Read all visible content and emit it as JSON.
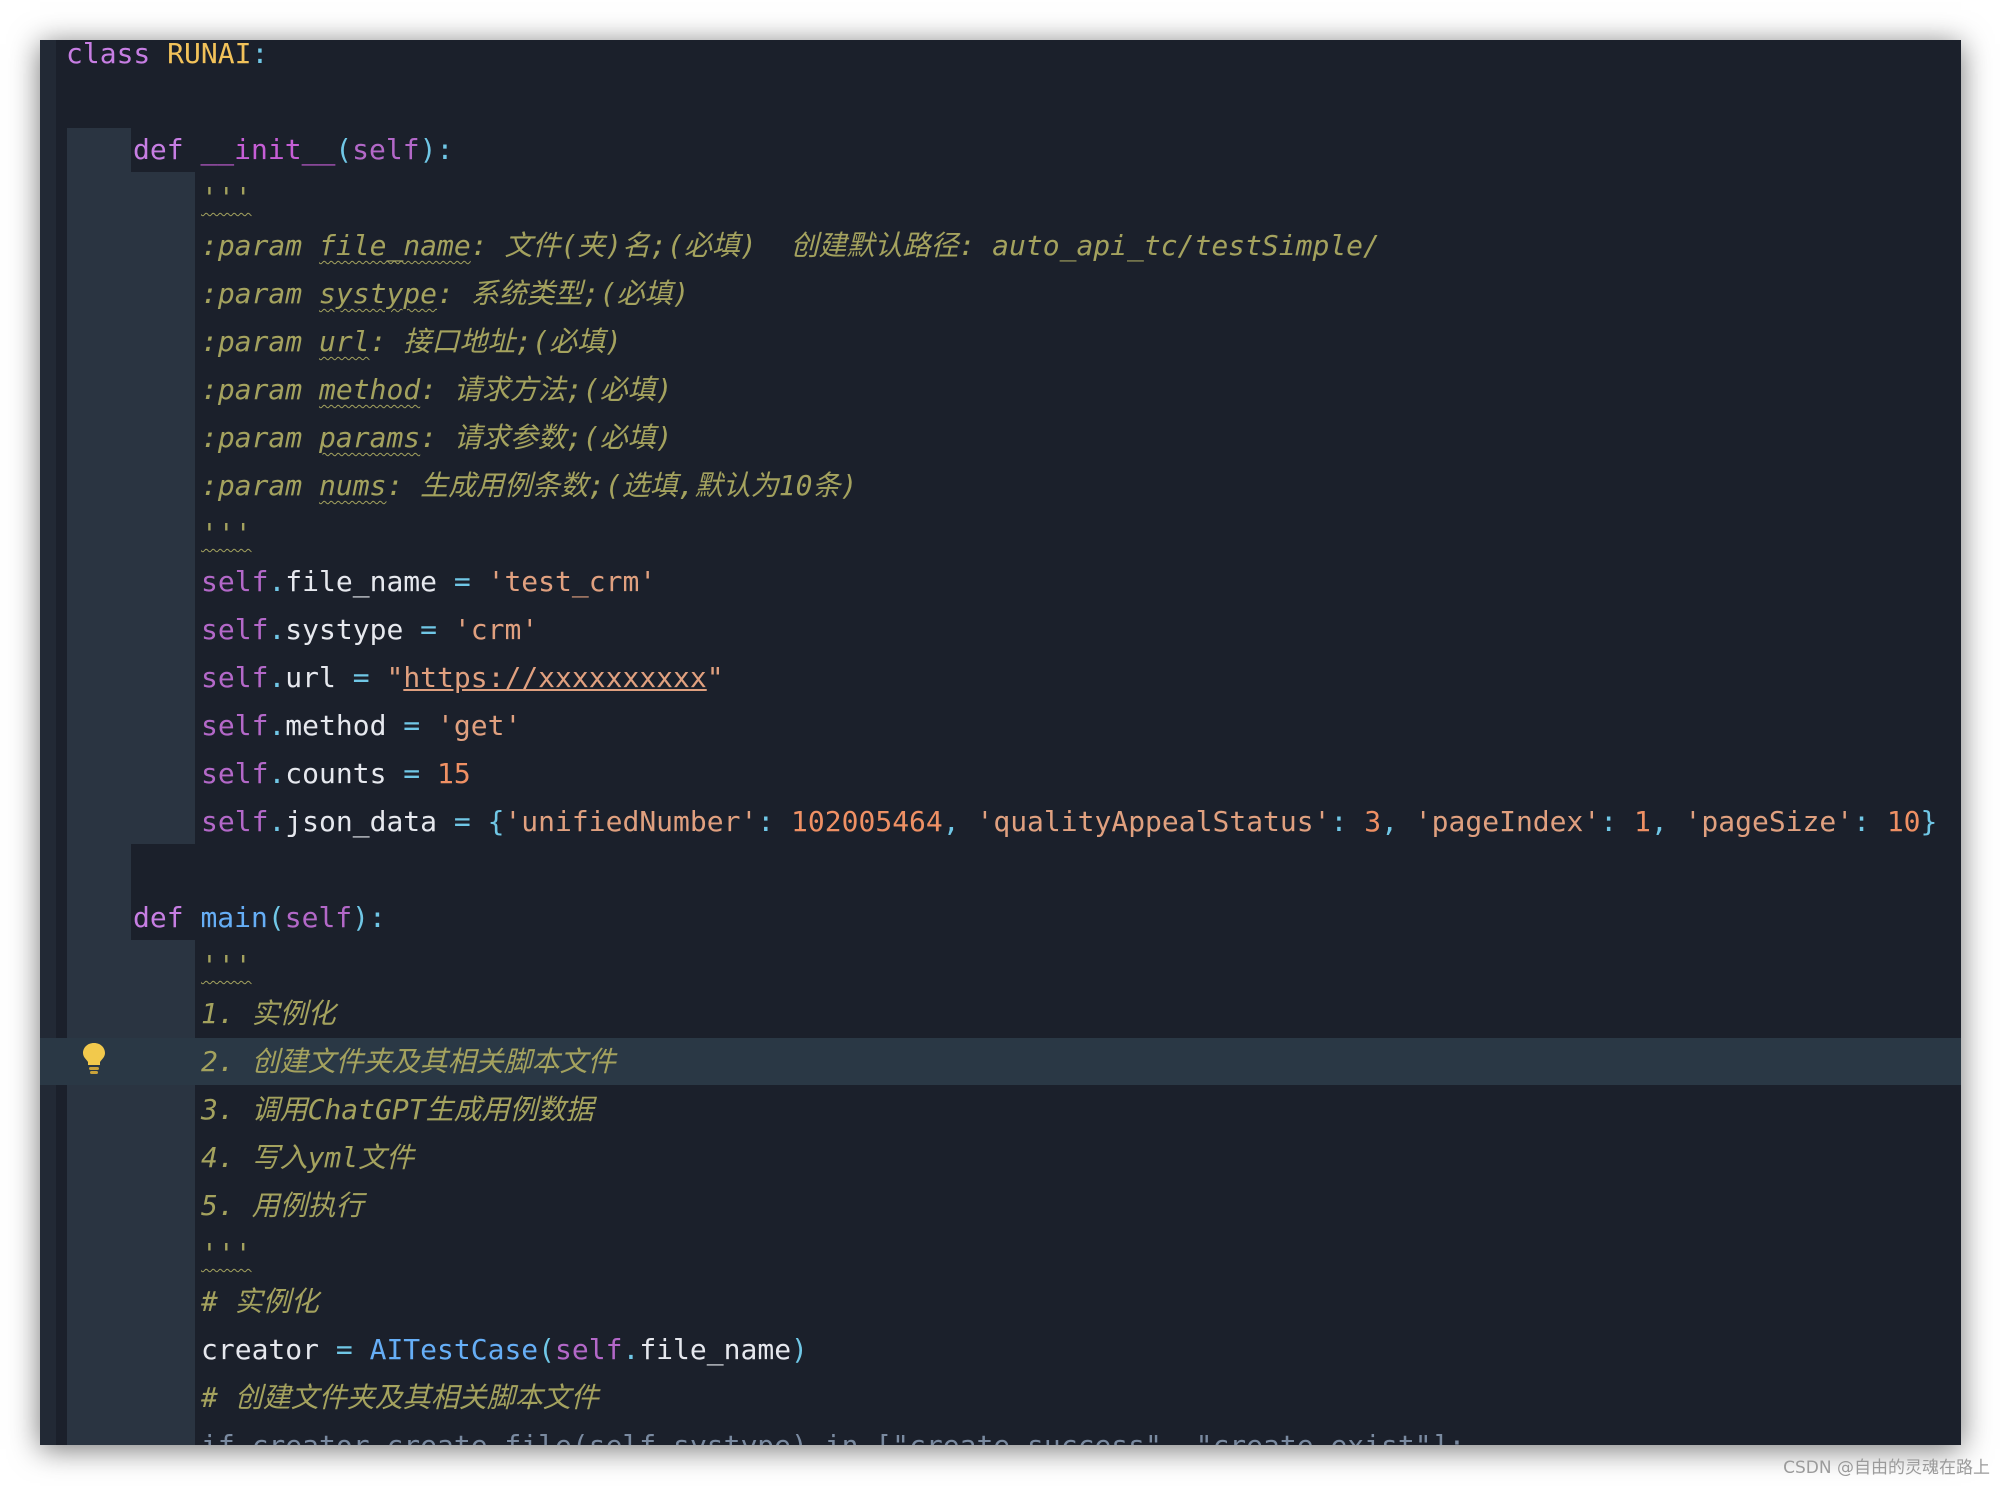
{
  "code": {
    "class_kw": "class",
    "class_name": "RUNAI",
    "colon": ":",
    "def_kw": "def",
    "init_name": "__init__",
    "main_name": "main",
    "self_kw": "self",
    "paren_open": "(",
    "paren_close_colon": "):",
    "triple_quote": "'''",
    "param_kw": ":param",
    "params": [
      {
        "name": "file_name",
        "desc": ": 文件(夹)名;(必填)  创建默认路径: auto_api_tc/testSimple/"
      },
      {
        "name": "systype",
        "desc": ": 系统类型;(必填)"
      },
      {
        "name": "url",
        "desc": ": 接口地址;(必填)"
      },
      {
        "name": "method",
        "desc": ": 请求方法;(必填)"
      },
      {
        "name": "params",
        "desc": ": 请求参数;(必填)"
      },
      {
        "name": "nums",
        "desc": ": 生成用例条数;(选填,默认为10条)"
      }
    ],
    "assign_op": " = ",
    "dot": ".",
    "file_name_attr": "file_name",
    "file_name_val": "'test_crm'",
    "systype_attr": "systype",
    "systype_val": "'crm'",
    "url_attr": "url",
    "url_quote": "\"",
    "url_val": "https://xxxxxxxxxx",
    "method_attr": "method",
    "method_val": "'get'",
    "counts_attr": "counts",
    "counts_val": "15",
    "json_attr": "json_data",
    "json": {
      "open": "{",
      "close": "}",
      "k1": "'unifiedNumber'",
      "v1": "102005464",
      "k2": "'qualityAppealStatus'",
      "v2": "3",
      "k3": "'pageIndex'",
      "v3": "1",
      "k4": "'pageSize'",
      "v4": "10",
      "colon": ": ",
      "comma": ", "
    },
    "steps": [
      "1. 实例化",
      "2. 创建文件夹及其相关脚本文件",
      "3. 调用ChatGPT生成用例数据",
      "4. 写入yml文件",
      "5. 用例执行"
    ],
    "comment1": "# 实例化",
    "creator_var": "creator",
    "ai_class": "AITestCase",
    "ai_open": "(",
    "ai_close": ")",
    "comment2": "# 创建文件夹及其相关脚本文件",
    "cut_line": "if creator.create_file(self.systype) in [\"create_success\", \"create_exist\"]:"
  },
  "watermark": "CSDN @自由的灵魂在路上"
}
